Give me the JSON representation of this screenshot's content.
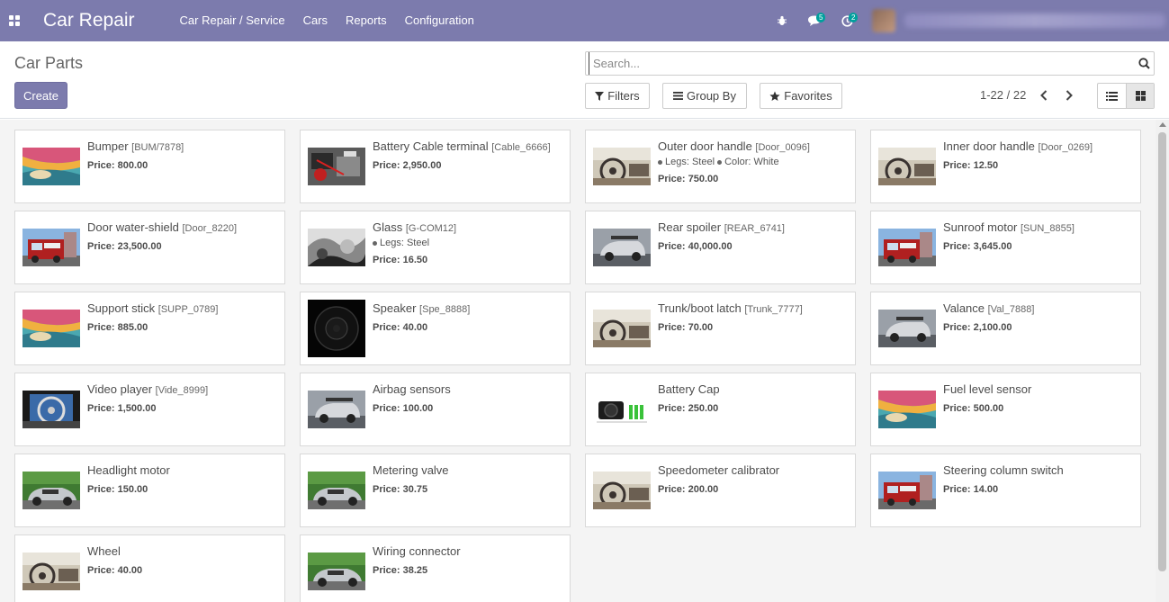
{
  "navbar": {
    "brand": "Car Repair",
    "menu": [
      "Car Repair / Service",
      "Cars",
      "Reports",
      "Configuration"
    ],
    "messages_count": "5",
    "activities_count": "2"
  },
  "control": {
    "title": "Car Parts",
    "create_label": "Create",
    "search_placeholder": "Search...",
    "filters_label": "Filters",
    "groupby_label": "Group By",
    "favorites_label": "Favorites",
    "pager": "1-22 / 22"
  },
  "cards": [
    {
      "name": "Bumper",
      "ref": "[BUM/7878]",
      "price": "Price: 800.00",
      "thumb": "carousel"
    },
    {
      "name": "Battery Cable terminal",
      "ref": "[Cable_6666]",
      "price": "Price: 2,950.00",
      "thumb": "engine"
    },
    {
      "name": "Outer door handle",
      "ref": "[Door_0096]",
      "attrs": "Legs: Steel  Color: White",
      "price": "Price: 750.00",
      "thumb": "dashboard"
    },
    {
      "name": "Inner door handle",
      "ref": "[Door_0269]",
      "price": "Price: 12.50",
      "thumb": "dashboard"
    },
    {
      "name": "Door water-shield",
      "ref": "[Door_8220]",
      "price": "Price: 23,500.00",
      "thumb": "firetruck"
    },
    {
      "name": "Glass",
      "ref": "[G-COM12]",
      "attrs": "Legs: Steel",
      "price": "Price: 16.50",
      "thumb": "bw"
    },
    {
      "name": "Rear spoiler",
      "ref": "[REAR_6741]",
      "price": "Price: 40,000.00",
      "thumb": "sportscar"
    },
    {
      "name": "Sunroof motor",
      "ref": "[SUN_8855]",
      "price": "Price: 3,645.00",
      "thumb": "firetruck"
    },
    {
      "name": "Support stick",
      "ref": "[SUPP_0789]",
      "price": "Price: 885.00",
      "thumb": "carousel"
    },
    {
      "name": "Speaker",
      "ref": "[Spe_8888]",
      "price": "Price: 40.00",
      "thumb": "speaker"
    },
    {
      "name": "Trunk/boot latch",
      "ref": "[Trunk_7777]",
      "price": "Price: 70.00",
      "thumb": "dashboard"
    },
    {
      "name": "Valance",
      "ref": "[Val_7888]",
      "price": "Price: 2,100.00",
      "thumb": "sportscar"
    },
    {
      "name": "Video player",
      "ref": "[Vide_8999]",
      "price": "Price: 1,500.00",
      "thumb": "steering"
    },
    {
      "name": "Airbag sensors",
      "ref": "",
      "price": "Price: 100.00",
      "thumb": "sportscar"
    },
    {
      "name": "Battery Cap",
      "ref": "",
      "price": "Price: 250.00",
      "thumb": "camera"
    },
    {
      "name": "Fuel level sensor",
      "ref": "",
      "price": "Price: 500.00",
      "thumb": "carousel"
    },
    {
      "name": "Headlight motor",
      "ref": "",
      "price": "Price: 150.00",
      "thumb": "silvercar"
    },
    {
      "name": "Metering valve",
      "ref": "",
      "price": "Price: 30.75",
      "thumb": "silvercar"
    },
    {
      "name": "Speedometer calibrator",
      "ref": "",
      "price": "Price: 200.00",
      "thumb": "dashboard"
    },
    {
      "name": "Steering column switch",
      "ref": "",
      "price": "Price: 14.00",
      "thumb": "firetruck"
    },
    {
      "name": "Wheel",
      "ref": "",
      "price": "Price: 40.00",
      "thumb": "dashboard"
    },
    {
      "name": "Wiring connector",
      "ref": "",
      "price": "Price: 38.25",
      "thumb": "silvercar"
    }
  ]
}
